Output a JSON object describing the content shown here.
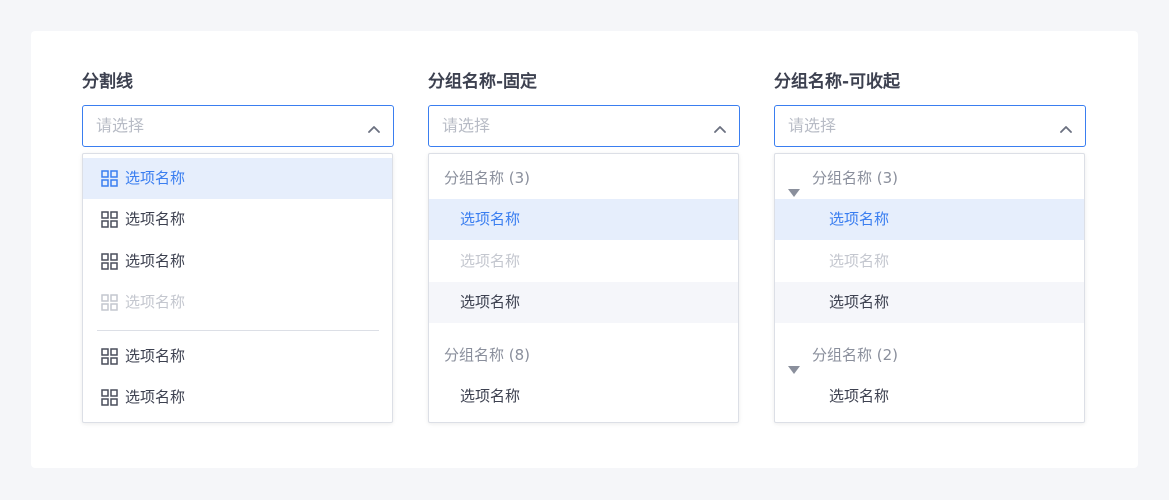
{
  "columns": [
    {
      "title": "分割线",
      "placeholder": "请选择",
      "items": [
        {
          "label": "选项名称",
          "state": "selected"
        },
        {
          "label": "选项名称",
          "state": "normal"
        },
        {
          "label": "选项名称",
          "state": "normal"
        },
        {
          "label": "选项名称",
          "state": "disabled"
        },
        {
          "label": "选项名称",
          "state": "normal"
        },
        {
          "label": "选项名称",
          "state": "normal"
        }
      ]
    },
    {
      "title": "分组名称-固定",
      "placeholder": "请选择",
      "groups": [
        {
          "label": "分组名称 (3)",
          "items": [
            {
              "label": "选项名称",
              "state": "selected"
            },
            {
              "label": "选项名称",
              "state": "disabled"
            },
            {
              "label": "选项名称",
              "state": "hover"
            }
          ]
        },
        {
          "label": "分组名称 (8)",
          "items": [
            {
              "label": "选项名称",
              "state": "normal"
            }
          ]
        }
      ]
    },
    {
      "title": "分组名称-可收起",
      "placeholder": "请选择",
      "groups": [
        {
          "label": "分组名称 (3)",
          "items": [
            {
              "label": "选项名称",
              "state": "selected"
            },
            {
              "label": "选项名称",
              "state": "disabled"
            },
            {
              "label": "选项名称",
              "state": "hover"
            }
          ]
        },
        {
          "label": "分组名称 (2)",
          "items": [
            {
              "label": "选项名称",
              "state": "normal"
            }
          ]
        }
      ]
    }
  ],
  "icons": {
    "select_toggle": "chevron-up-icon",
    "option": "grid-icon",
    "group_toggle": "caret-down-icon"
  },
  "colors": {
    "accent": "#3a7ef0",
    "selected_bg": "#e6eefc",
    "hover_bg": "#f5f6fa",
    "disabled_text": "#c4c7cf",
    "group_text": "#8a8f9c",
    "text": "#3d4150"
  }
}
